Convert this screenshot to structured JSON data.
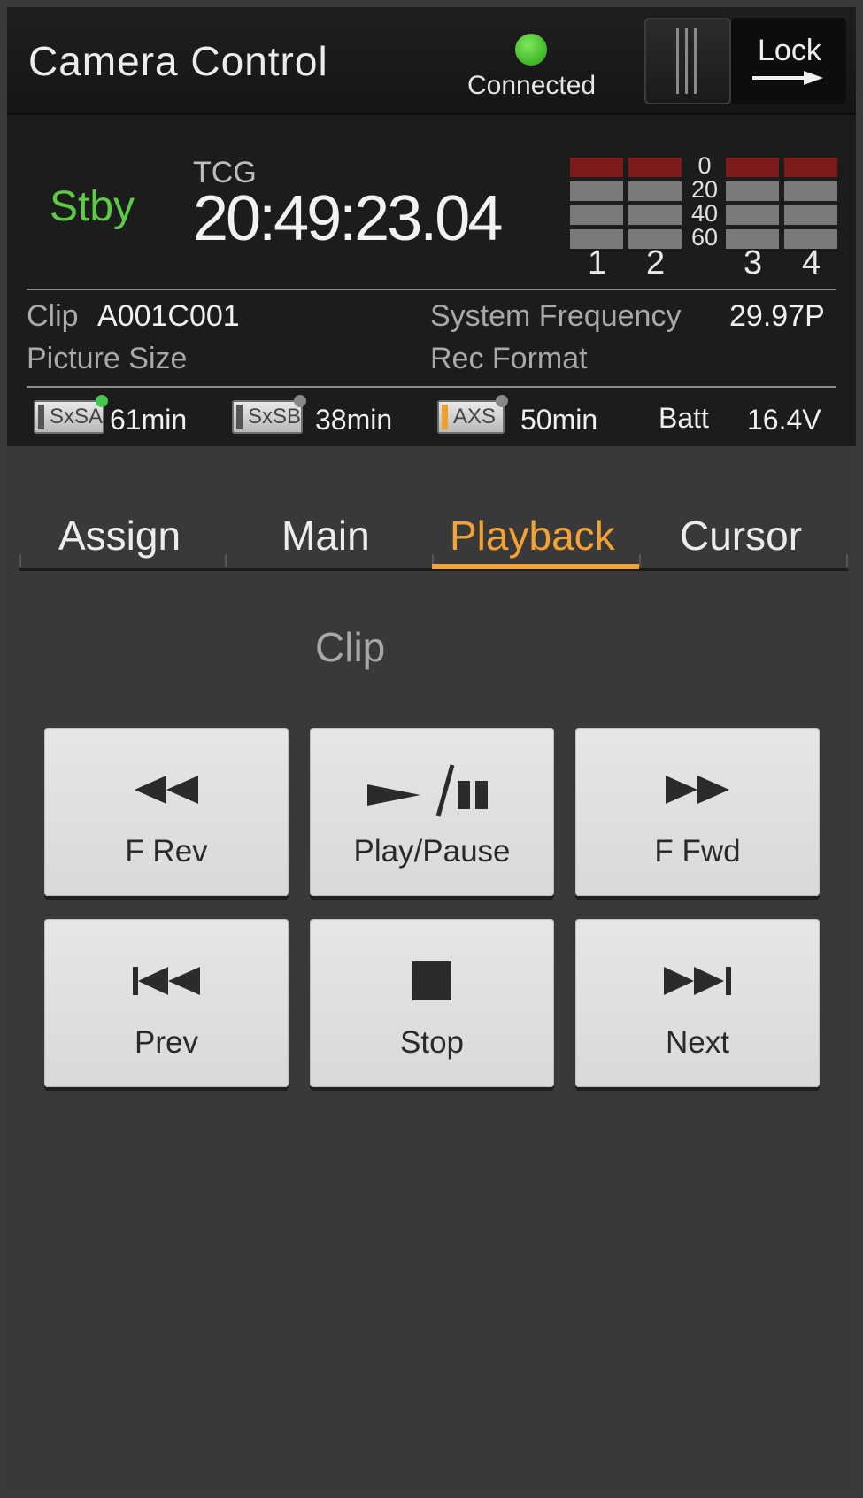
{
  "header": {
    "title": "Camera Control",
    "connection_status": "Connected",
    "lock_label": "Lock",
    "connection_color": "#4ccb35"
  },
  "status": {
    "mode": "Stby",
    "timecode_label": "TCG",
    "timecode": "20:49:23.04",
    "meter_scale": [
      "0",
      "20",
      "40",
      "60"
    ],
    "meter_channels": [
      "1",
      "2",
      "3",
      "4"
    ],
    "clip_label": "Clip",
    "clip_value": "A001C001",
    "system_frequency_label": "System Frequency",
    "system_frequency_value": "29.97P",
    "picture_size_label": "Picture Size",
    "rec_format_label": "Rec Format",
    "media": [
      {
        "icon": "SxSA",
        "time": "61min",
        "active": true
      },
      {
        "icon": "SxSB",
        "time": "38min",
        "active": false
      },
      {
        "icon": "AXS",
        "time": "50min",
        "active": false
      }
    ],
    "battery_label": "Batt",
    "battery_value": "16.4V"
  },
  "tabs": [
    {
      "label": "Assign",
      "active": false
    },
    {
      "label": "Main",
      "active": false
    },
    {
      "label": "Playback",
      "active": true
    },
    {
      "label": "Cursor",
      "active": false
    }
  ],
  "section_title": "Clip",
  "buttons": [
    {
      "label": "F Rev",
      "icon": "fast-rewind-icon"
    },
    {
      "label": "Play/Pause",
      "icon": "play-pause-icon"
    },
    {
      "label": "F Fwd",
      "icon": "fast-forward-icon"
    },
    {
      "label": "Prev",
      "icon": "skip-previous-icon"
    },
    {
      "label": "Stop",
      "icon": "stop-icon"
    },
    {
      "label": "Next",
      "icon": "skip-next-icon"
    }
  ],
  "colors": {
    "accent": "#f3a233",
    "standby": "#5ecb45",
    "meter_peak": "#7c1b1b"
  }
}
